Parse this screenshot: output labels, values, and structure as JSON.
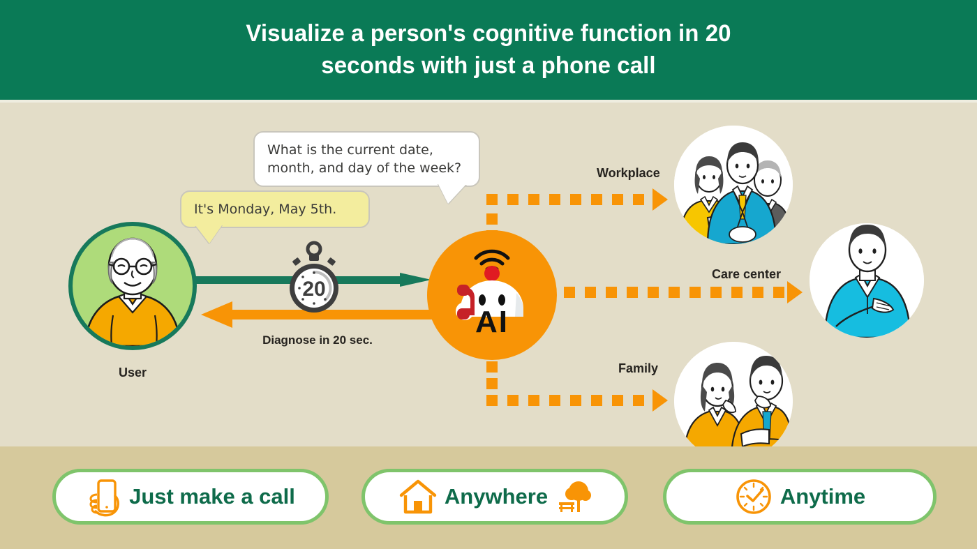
{
  "header": {
    "title": "Visualize a person's cognitive function in 20 seconds with just a phone call",
    "background_color": "#0A7A56",
    "text_color": "#FFFFFF"
  },
  "palette": {
    "panel_background": "#E3DDC8",
    "band_background": "#D6C99C",
    "orange": "#F89406",
    "dark_green": "#0E6B4A",
    "user_circle_fill": "#AEDB7A",
    "user_circle_border": "#17795B",
    "answer_bubble_fill": "#F3ED9E",
    "pill_border": "#7FC46B",
    "stopwatch_color": "#3E3E3E",
    "handset_red": "#C62127"
  },
  "conversation": {
    "question": {
      "text": "What is the current date, month, and day of the week?",
      "speaker": "ai",
      "style": "white"
    },
    "answer": {
      "text": "It's Monday, May 5th.",
      "speaker": "user",
      "style": "yellow"
    }
  },
  "user_node": {
    "label": "User",
    "icon": "elderly-man-avatar"
  },
  "flow": {
    "forward_arrow": {
      "direction": "right",
      "color": "#17795B",
      "icon": "right-arrow"
    },
    "return_arrow": {
      "direction": "left",
      "color": "#F89406",
      "icon": "left-arrow"
    },
    "timer": {
      "value": "20",
      "caption": "Diagnose in 20 sec.",
      "icon": "stopwatch-icon"
    }
  },
  "ai_node": {
    "label": "AI",
    "icon": "ai-robot-phone-icon",
    "antenna_icon": "wifi-signal-icon",
    "handset_icon": "telephone-handset-icon"
  },
  "destinations": [
    {
      "label": "Workplace",
      "icon": "business-team-avatar",
      "connector": "dotted-arrow-up-right"
    },
    {
      "label": "Care center",
      "icon": "caregiver-avatar",
      "connector": "dotted-arrow-right"
    },
    {
      "label": "Family",
      "icon": "family-couple-avatar",
      "connector": "dotted-arrow-down-right"
    }
  ],
  "features": [
    {
      "label": "Just make a call",
      "icon": "hand-holding-phone-icon",
      "trailing_icon": ""
    },
    {
      "label": "Anywhere",
      "icon": "house-icon",
      "trailing_icon": "tree-bench-icon"
    },
    {
      "label": "Anytime",
      "icon": "clock-icon",
      "trailing_icon": ""
    }
  ]
}
